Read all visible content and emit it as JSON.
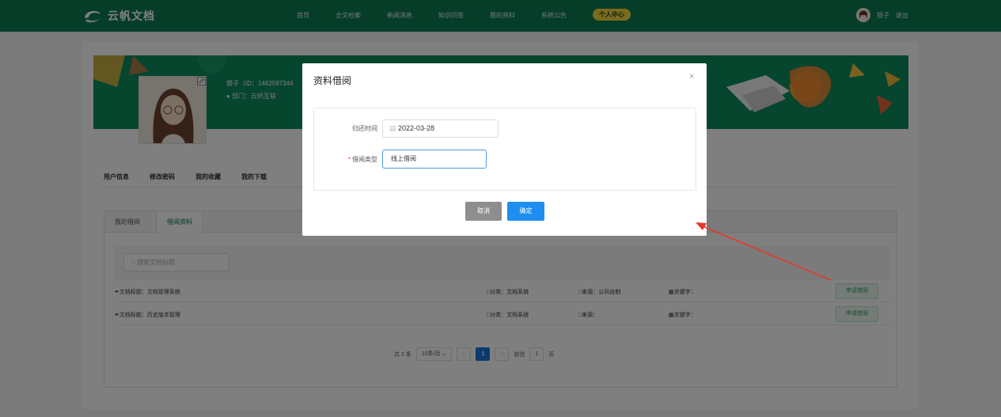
{
  "header": {
    "logo_text": "云帆文档",
    "nav": [
      "首页",
      "全文检索",
      "新闻消息",
      "知识问答",
      "我的资料",
      "系统公告",
      "个人中心"
    ],
    "user_name": "银子",
    "logout": "退出"
  },
  "profile": {
    "name": "银子（ID：1462597344",
    "dept": "部门：云帆互联"
  },
  "profile_tabs": [
    "用户信息",
    "修改密码",
    "我的收藏",
    "我的下载"
  ],
  "sub_tabs": [
    "我的借阅",
    "借阅资料"
  ],
  "search": {
    "placeholder": "搜索文档标题"
  },
  "rows": [
    {
      "title": "文档标题：文档管理系统",
      "category": "分类：文档系统",
      "source": "来源：公司自制",
      "keyword": "关键字：",
      "action": "申请借阅"
    },
    {
      "title": "文档标题：历史版本管理",
      "category": "分类：文档系统",
      "source": "来源：",
      "keyword": "关键字：",
      "action": "申请借阅"
    }
  ],
  "pager": {
    "total": "共 2 条",
    "size": "10条/页",
    "page": "1",
    "goto_prefix": "前往",
    "goto_value": "1",
    "goto_suffix": "页"
  },
  "modal": {
    "title": "资料借阅",
    "close": "×",
    "return_label": "归还时间",
    "return_value": "2022-03-28",
    "type_required": "*",
    "type_label": "借阅类型",
    "type_value": "线上借阅",
    "cancel": "取消",
    "confirm": "确定"
  },
  "colors": {
    "header_green": "#0b7a53",
    "accent_yellow": "#f5d63b",
    "primary_blue": "#1e8ff0",
    "annotation_red": "#e8372b"
  }
}
